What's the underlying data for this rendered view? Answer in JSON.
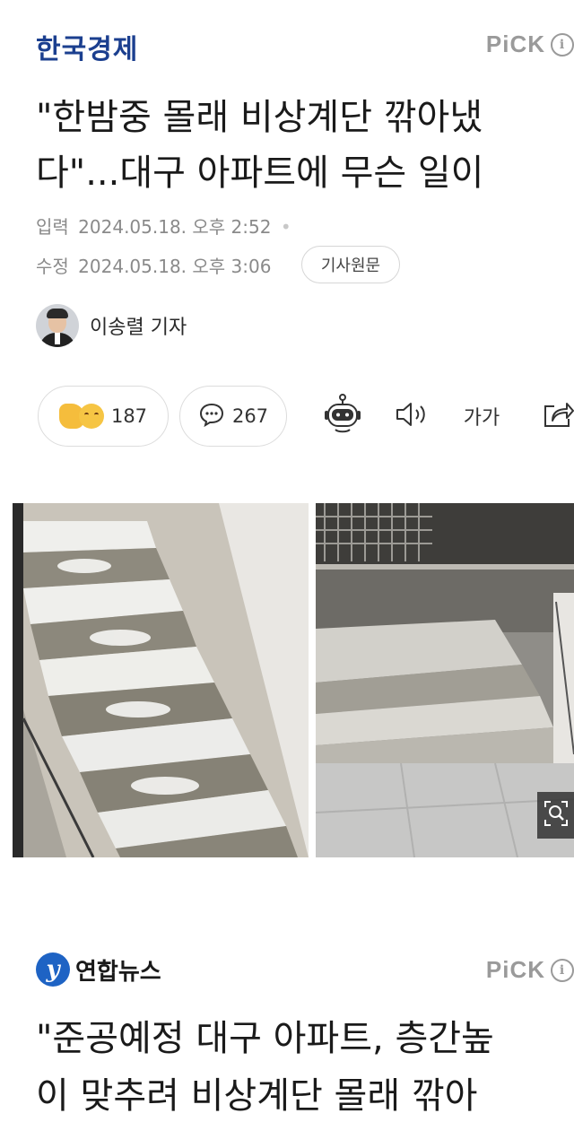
{
  "article1": {
    "press": "한국경제",
    "pick": "PiCK",
    "headline_lines": [
      "\"한밤중 몰래 비상계단 깎아냈",
      "다\"...대구 아파트에 무슨 일이"
    ],
    "published_label": "입력",
    "published": "2024.05.18. 오후 2:52",
    "modified_label": "수정",
    "modified": "2024.05.18. 오후 3:06",
    "original_button": "기사원문",
    "reporter": "이송렬 기자",
    "reaction_count": "187",
    "comment_count": "267",
    "font_size_label": "가가",
    "icons": {
      "info": "info-icon",
      "reaction": "thumbs-up-emoji",
      "comment": "comment-bubble-icon",
      "summary_bot": "robot-icon",
      "tts": "speaker-icon",
      "share": "share-icon",
      "zoom": "magnifier-icon"
    }
  },
  "article2": {
    "press": "연합뉴스",
    "pick": "PiCK",
    "headline_lines": [
      "\"준공예정 대구 아파트, 층간높",
      "이 맞추려 비상계단 몰래 깎아"
    ]
  },
  "colors": {
    "hankyung_blue": "#1b3f8f",
    "yonhap_blue": "#1e63c4",
    "muted_gray": "#8a8a8a"
  }
}
